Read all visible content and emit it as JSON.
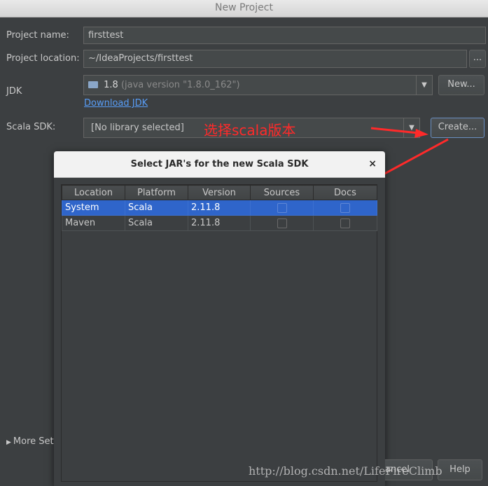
{
  "window": {
    "title": "New Project"
  },
  "form": {
    "project_name_label": "Project name:",
    "project_name_value": "firsttest",
    "project_location_label": "Project location:",
    "project_location_value": "~/IdeaProjects/firsttest",
    "browse_label": "...",
    "jdk_label": "JDK",
    "jdk_version": "1.8",
    "jdk_detail": "(java version \"1.8.0_162\")",
    "jdk_new_button": "New...",
    "download_jdk_link": "Download JDK",
    "scala_sdk_label": "Scala SDK:",
    "scala_sdk_value": "[No library selected]",
    "create_button": "Create...",
    "more_settings": "More Set",
    "cancel_fragment": "ancel",
    "help_fragment": "Help"
  },
  "annotation": {
    "text": "选择scala版本",
    "color": "#ff2a2a"
  },
  "dialog": {
    "title": "Select JAR's for the new Scala SDK",
    "close_label": "×",
    "columns": [
      "Location",
      "Platform",
      "Version",
      "Sources",
      "Docs"
    ],
    "rows": [
      {
        "location": "System",
        "platform": "Scala",
        "version": "2.11.8",
        "sources": false,
        "docs": false,
        "selected": true
      },
      {
        "location": "Maven",
        "platform": "Scala",
        "version": "2.11.8",
        "sources": false,
        "docs": false,
        "selected": false
      }
    ]
  },
  "watermark": "http://blog.csdn.net/LifeFireClimb",
  "colors": {
    "background": "#3c3f41",
    "selection": "#2f65ca",
    "link": "#589df6",
    "annotation": "#ff2a2a"
  }
}
